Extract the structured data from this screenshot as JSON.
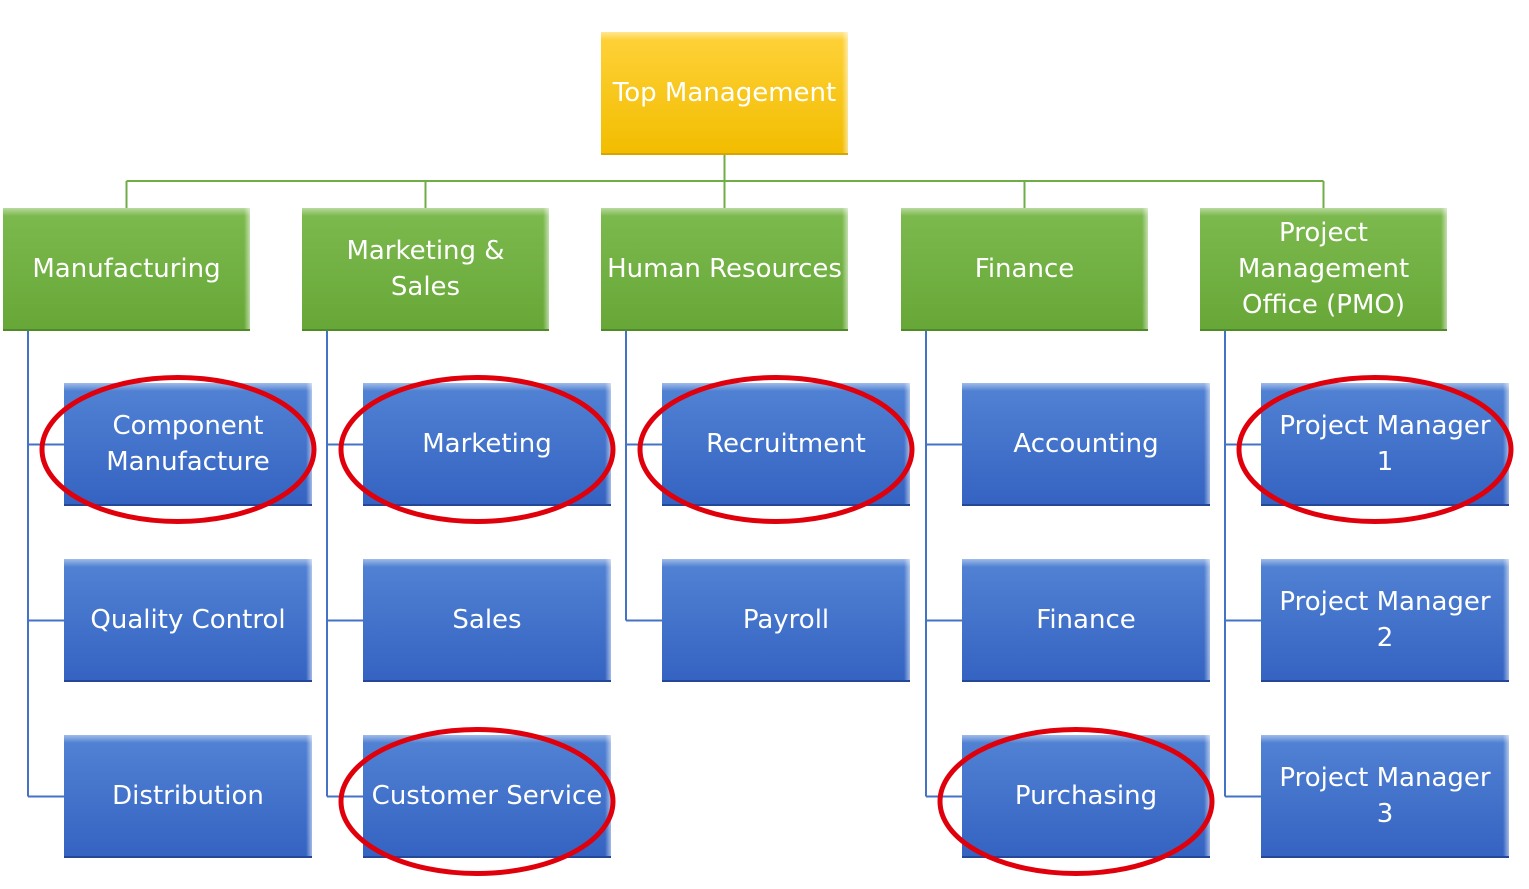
{
  "diagram": {
    "type": "org-chart",
    "colors": {
      "top": "#F5C000",
      "department": "#70AD47",
      "unit": "#4472C4",
      "connector_top": "#70AD47",
      "connector_unit": "#4472C4",
      "highlight": "#E0000B"
    },
    "root": {
      "label": "Top Management"
    },
    "departments": [
      {
        "label": "Manufacturing",
        "units": [
          {
            "label": "Component\nManufacture",
            "highlighted": true
          },
          {
            "label": "Quality Control",
            "highlighted": false
          },
          {
            "label": "Distribution",
            "highlighted": false
          }
        ]
      },
      {
        "label": "Marketing &\nSales",
        "units": [
          {
            "label": "Marketing",
            "highlighted": true
          },
          {
            "label": "Sales",
            "highlighted": false
          },
          {
            "label": "Customer Service",
            "highlighted": true
          }
        ]
      },
      {
        "label": "Human Resources",
        "units": [
          {
            "label": "Recruitment",
            "highlighted": true
          },
          {
            "label": "Payroll",
            "highlighted": false
          }
        ]
      },
      {
        "label": "Finance",
        "units": [
          {
            "label": "Accounting",
            "highlighted": false
          },
          {
            "label": "Finance",
            "highlighted": false
          },
          {
            "label": "Purchasing",
            "highlighted": true
          }
        ]
      },
      {
        "label": "Project\nManagement\nOffice (PMO)",
        "units": [
          {
            "label": "Project Manager\n1",
            "highlighted": true
          },
          {
            "label": "Project Manager\n2",
            "highlighted": false
          },
          {
            "label": "Project Manager\n3",
            "highlighted": false
          }
        ]
      }
    ]
  }
}
